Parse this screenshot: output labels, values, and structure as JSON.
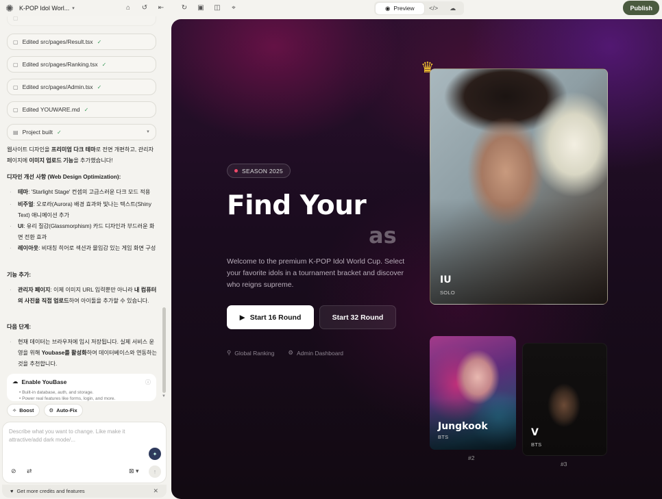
{
  "topbar": {
    "project_title": "K-POP Idol Worl...",
    "preview_label": "Preview",
    "publish_label": "Publish"
  },
  "chat": {
    "files": [
      {
        "label": "Edited src/pages/Result.tsx"
      },
      {
        "label": "Edited src/pages/Ranking.tsx"
      },
      {
        "label": "Edited src/pages/Admin.tsx"
      },
      {
        "label": "Edited YOUWARE.md"
      }
    ],
    "project_built": "Project built",
    "intro_a": "웹사이트 디자인을 ",
    "intro_b": "프리미엄 다크 테마",
    "intro_c": "로 전면 개편하고, 관리자 페이지에 ",
    "intro_d": "이미지 업로드 기능",
    "intro_e": "을 추가했습니다!",
    "design_heading": "디자인 개선 사항 (Web Design Optimization):",
    "design_items": [
      {
        "k": "테마",
        "v": ": 'Starlight Stage' 컨셉의 고급스러운 다크 모드 적용"
      },
      {
        "k": "비주얼",
        "v": ": 오로라(Aurora) 배경 효과와 빛나는 텍스트(Shiny Text) 애니메이션 추가"
      },
      {
        "k": "UI",
        "v": ": 유리 질감(Glassmorphism) 카드 디자인과 부드러운 화면 전환 효과"
      },
      {
        "k": "레이아웃",
        "v": ": 비대칭 히어로 섹션과 몰입감 있는 게임 화면 구성"
      }
    ],
    "feature_heading": "기능 추가:",
    "feature_k": "관리자 페이지",
    "feature_v1": ": 이제 이미지 URL 입력뿐만 아니라 ",
    "feature_b": "내 컴퓨터의 사진을 직접 업로드",
    "feature_v2": "하여 아이돌을 추가할 수 있습니다.",
    "next_heading": "다음 단계:",
    "next_a": "현재 데이터는 브라우저에 임시 저장됩니다. 실제 서비스 운영을 위해 ",
    "next_b": "Youbase를 활성화",
    "next_c": "하여 데이터베이스와 연동하는 것을 추천합니다.",
    "youbase_title": "Enable YouBase",
    "youbase_items": [
      "Built-in database, auth, and storage.",
      "Power real features like forms, login, and more."
    ],
    "chip_boost": "Boost",
    "chip_autofix": "Auto-Fix",
    "composer_placeholder": "Describe what you want to change. Like make it attractive/add dark mode/...",
    "credits_label": "Get more credits and features"
  },
  "preview": {
    "season_label": "SEASON 2025",
    "hero_title": "Find Your",
    "hero_ghost": "as",
    "hero_desc": "Welcome to the premium K-POP Idol World Cup. Select your favorite idols in a tournament bracket and discover who reigns supreme.",
    "btn_16": "Start 16 Round",
    "btn_32": "Start 32 Round",
    "link_ranking": "Global Ranking",
    "link_admin": "Admin Dashboard",
    "cards": [
      {
        "name": "IU",
        "group": "SOLO"
      },
      {
        "name": "Jungkook",
        "group": "BTS",
        "rank": "#2"
      },
      {
        "name": "V",
        "group": "BTS",
        "rank": "#3"
      }
    ]
  },
  "colors": {
    "publish_bg": "#4a5a3f",
    "accent_red_dot": "#f04a6a",
    "crown": "#f2c230",
    "check_green": "#3a9a5a"
  }
}
